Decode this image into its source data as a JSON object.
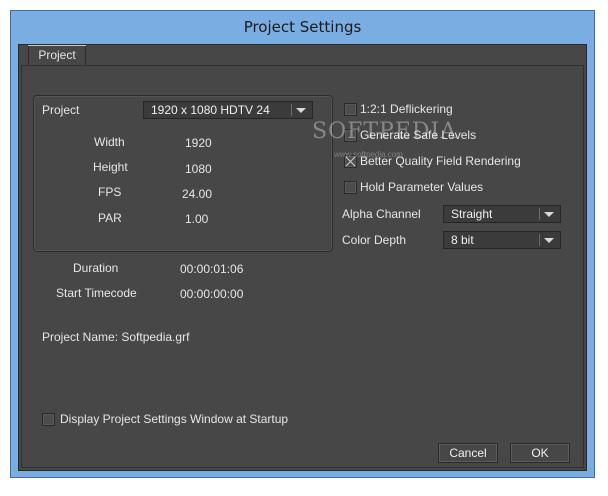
{
  "window": {
    "title": "Project Settings"
  },
  "tabs": [
    {
      "label": "Project"
    }
  ],
  "project": {
    "label": "Project",
    "preset_value": "1920 x 1080 HDTV 24",
    "rows": [
      {
        "label": "Width",
        "value": "1920"
      },
      {
        "label": "Height",
        "value": "1080"
      },
      {
        "label": "FPS",
        "value": "24.00"
      },
      {
        "label": "PAR",
        "value": "1.00"
      }
    ]
  },
  "timing": {
    "duration_label": "Duration",
    "duration_value": "00:00:01:06",
    "start_label": "Start Timecode",
    "start_value": "00:00:00:00"
  },
  "project_name": "Project Name: Softpedia.grf",
  "options": [
    {
      "label": "1:2:1 Deflickering",
      "checked": false
    },
    {
      "label": "Generate Safe Levels",
      "checked": false
    },
    {
      "label": "Better Quality Field Rendering",
      "checked": true
    },
    {
      "label": "Hold Parameter Values",
      "checked": false
    }
  ],
  "alpha_channel": {
    "label": "Alpha Channel",
    "value": "Straight"
  },
  "color_depth": {
    "label": "Color Depth",
    "value": "8 bit"
  },
  "startup_option": {
    "label": "Display Project Settings Window at Startup",
    "checked": false
  },
  "buttons": {
    "cancel": "Cancel",
    "ok": "OK"
  },
  "watermark": {
    "text": "SOFTPEDIA",
    "url": "www.softpedia.com"
  },
  "colors": {
    "titlebar": "#7aaee3",
    "client_bg": "#474747",
    "text": "#e6e6e6"
  }
}
